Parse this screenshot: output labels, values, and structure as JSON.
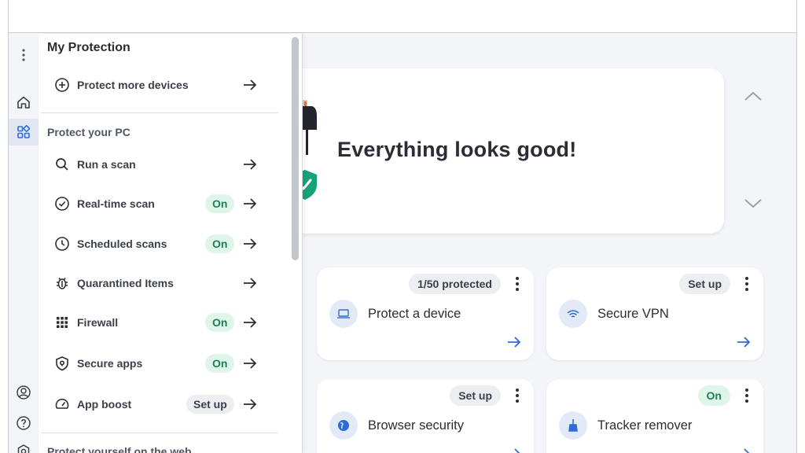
{
  "hero": {
    "title": "Everything looks good!",
    "collapse_icon": "chevron-up-icon",
    "expand_icon": "chevron-down-icon"
  },
  "rail": {
    "items": [
      {
        "name": "more-options",
        "icon": "kebab-icon"
      },
      {
        "name": "home",
        "icon": "home-icon"
      },
      {
        "name": "protection",
        "icon": "apps-grid-icon",
        "active": true
      },
      {
        "name": "account",
        "icon": "user-icon"
      },
      {
        "name": "help",
        "icon": "help-icon"
      },
      {
        "name": "settings",
        "icon": "settings-icon"
      }
    ]
  },
  "flyout": {
    "title": "My Protection",
    "protect_more": {
      "label": "Protect more devices",
      "icon": "plus-circle-icon"
    },
    "section_pc": "Protect your PC",
    "items": [
      {
        "label": "Run a scan",
        "icon": "search-icon",
        "badge": ""
      },
      {
        "label": "Real-time scan",
        "icon": "check-circle-icon",
        "badge": "On"
      },
      {
        "label": "Scheduled scans",
        "icon": "clock-icon",
        "badge": "On"
      },
      {
        "label": "Quarantined Items",
        "icon": "bug-icon",
        "badge": ""
      },
      {
        "label": "Firewall",
        "icon": "firewall-grid-icon",
        "badge": "On"
      },
      {
        "label": "Secure apps",
        "icon": "shield-lock-icon",
        "badge": "On"
      },
      {
        "label": "App boost",
        "icon": "speedometer-icon",
        "badge": "Set up"
      }
    ],
    "section_web": "Protect yourself on the web"
  },
  "cards": [
    {
      "title": "Protect a device",
      "badge": "1/50 protected",
      "icon": "laptop-icon"
    },
    {
      "title": "Secure VPN",
      "badge": "Set up",
      "icon": "vpn-wifi-icon"
    },
    {
      "title": "Browser security",
      "badge": "Set up",
      "icon": "globe-icon"
    },
    {
      "title": "Tracker remover",
      "badge": "On",
      "icon": "broom-icon"
    }
  ],
  "colors": {
    "accent": "#2f6bd6",
    "on_badge_bg": "#dff5ea",
    "on_badge_text": "#1d7f53",
    "shield": "#17a27a"
  }
}
